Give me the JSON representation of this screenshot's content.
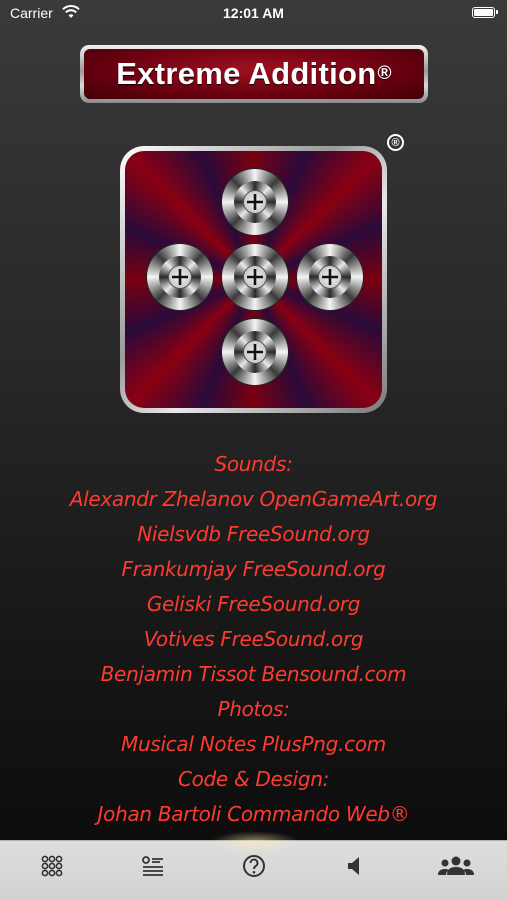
{
  "status_bar": {
    "carrier": "Carrier",
    "time": "12:01 AM"
  },
  "title": {
    "text": "Extreme Addition",
    "mark": "®"
  },
  "logo": {
    "mark": "®",
    "icon": "plus-cross-logo"
  },
  "credits": [
    "Sounds:",
    "Alexandr Zhelanov OpenGameArt.org",
    "Nielsvdb FreeSound.org",
    "Frankumjay FreeSound.org",
    "Geliski FreeSound.org",
    "Votives FreeSound.org",
    "Benjamin Tissot Bensound.com",
    "Photos:",
    "Musical Notes PlusPng.com",
    "Code & Design:",
    "Johan Bartoli Commando Web®"
  ],
  "tab_bar": {
    "items": [
      {
        "icon": "grid-icon"
      },
      {
        "icon": "list-icon"
      },
      {
        "icon": "help-icon"
      },
      {
        "icon": "speaker-icon"
      },
      {
        "icon": "people-icon"
      }
    ]
  },
  "colors": {
    "credit_text": "#ff3b30",
    "banner": "#7a0010",
    "tab_bar": "#d6d6d6"
  }
}
